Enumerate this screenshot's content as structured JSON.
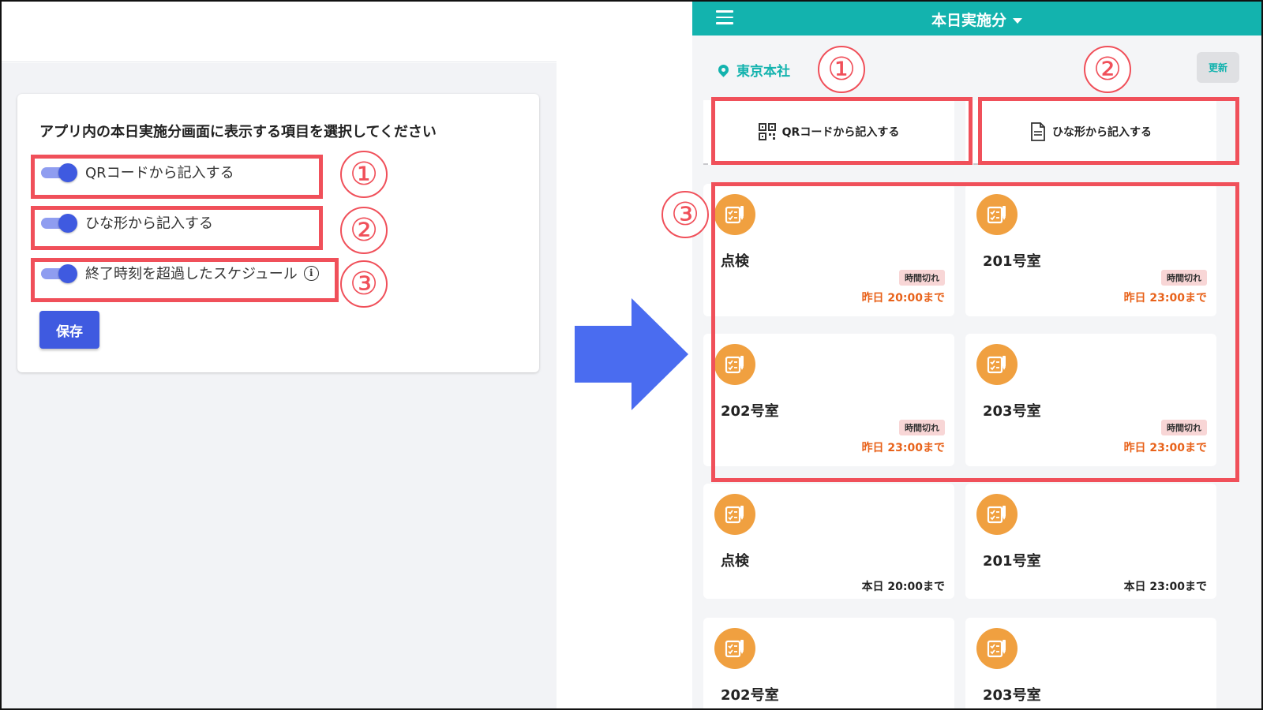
{
  "settings": {
    "title": "アプリ内の本日実施分画面に表示する項目を選択してください",
    "toggles": [
      {
        "label": "QRコードから記入する",
        "on": true
      },
      {
        "label": "ひな形から記入する",
        "on": true
      },
      {
        "label": "終了時刻を超過したスケジュール",
        "on": true
      }
    ],
    "info_icon_glyph": "i",
    "save_label": "保存"
  },
  "markers": [
    "①",
    "②",
    "③"
  ],
  "app": {
    "title": "本日実施分",
    "location": "東京本社",
    "refresh_label": "更新",
    "qr_button_label": "QRコードから記入する",
    "template_button_label": "ひな形から記入する",
    "tasks": [
      {
        "name": "点検",
        "badge": "時間切れ",
        "deadline": "昨日 20:00まで",
        "overdue": true
      },
      {
        "name": "201号室",
        "badge": "時間切れ",
        "deadline": "昨日 23:00まで",
        "overdue": true
      },
      {
        "name": "202号室",
        "badge": "時間切れ",
        "deadline": "昨日 23:00まで",
        "overdue": true
      },
      {
        "name": "203号室",
        "badge": "時間切れ",
        "deadline": "昨日 23:00まで",
        "overdue": true
      },
      {
        "name": "点検",
        "deadline": "本日 20:00まで",
        "overdue": false
      },
      {
        "name": "201号室",
        "deadline": "本日 23:00まで",
        "overdue": false
      },
      {
        "name": "202号室",
        "overdue": false
      },
      {
        "name": "203号室",
        "overdue": false
      }
    ]
  },
  "colors": {
    "primary": "#3f5ae0",
    "teal": "#13b3ae",
    "highlight": "#f0505a",
    "task_icon": "#f0a040",
    "overdue": "#e8621a"
  },
  "icons": [
    "menu-icon",
    "caret-down-icon",
    "map-pin-icon",
    "qr-code-icon",
    "document-icon",
    "checklist-icon",
    "info-icon",
    "arrow-right-icon"
  ]
}
